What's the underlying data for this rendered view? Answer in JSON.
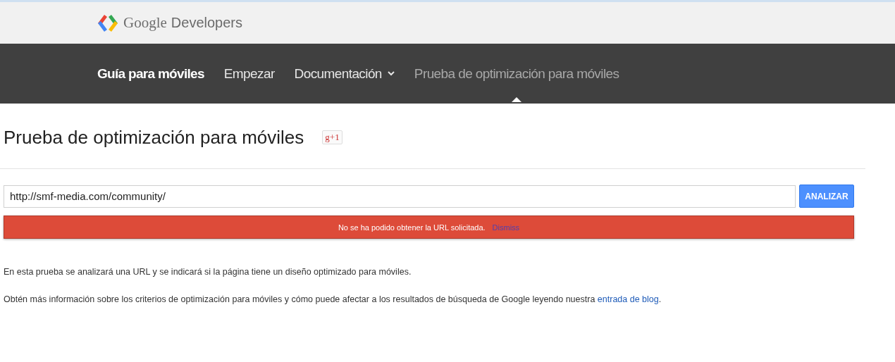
{
  "header": {
    "logo_text_1": "Google",
    "logo_text_2": "Developers"
  },
  "nav": {
    "items": [
      {
        "label": "Guía para móviles",
        "kind": "brand",
        "selected": false,
        "has_menu": false
      },
      {
        "label": "Empezar",
        "kind": "link",
        "selected": false,
        "has_menu": false
      },
      {
        "label": "Documentación",
        "kind": "link",
        "selected": false,
        "has_menu": true
      },
      {
        "label": "Prueba de optimización para móviles",
        "kind": "link",
        "selected": true,
        "has_menu": false
      }
    ]
  },
  "page": {
    "title": "Prueba de optimización para móviles",
    "plus_one": "g+1",
    "url_field": {
      "value": "http://smf-media.com/community/"
    },
    "analyze_button": "ANALIZAR",
    "error": {
      "message": "No se ha podido obtener la URL solicitada.",
      "dismiss": "Dismiss"
    },
    "paragraphs": [
      {
        "text": "En esta prueba se analizará una URL y se indicará si la página tiene un diseño optimizado para móviles."
      },
      {
        "text": "Obtén más información sobre los criterios de optimización para móviles y cómo puede afectar a los resultados de búsqueda de Google leyendo nuestra ",
        "link": "entrada de blog",
        "after": "."
      }
    ]
  }
}
